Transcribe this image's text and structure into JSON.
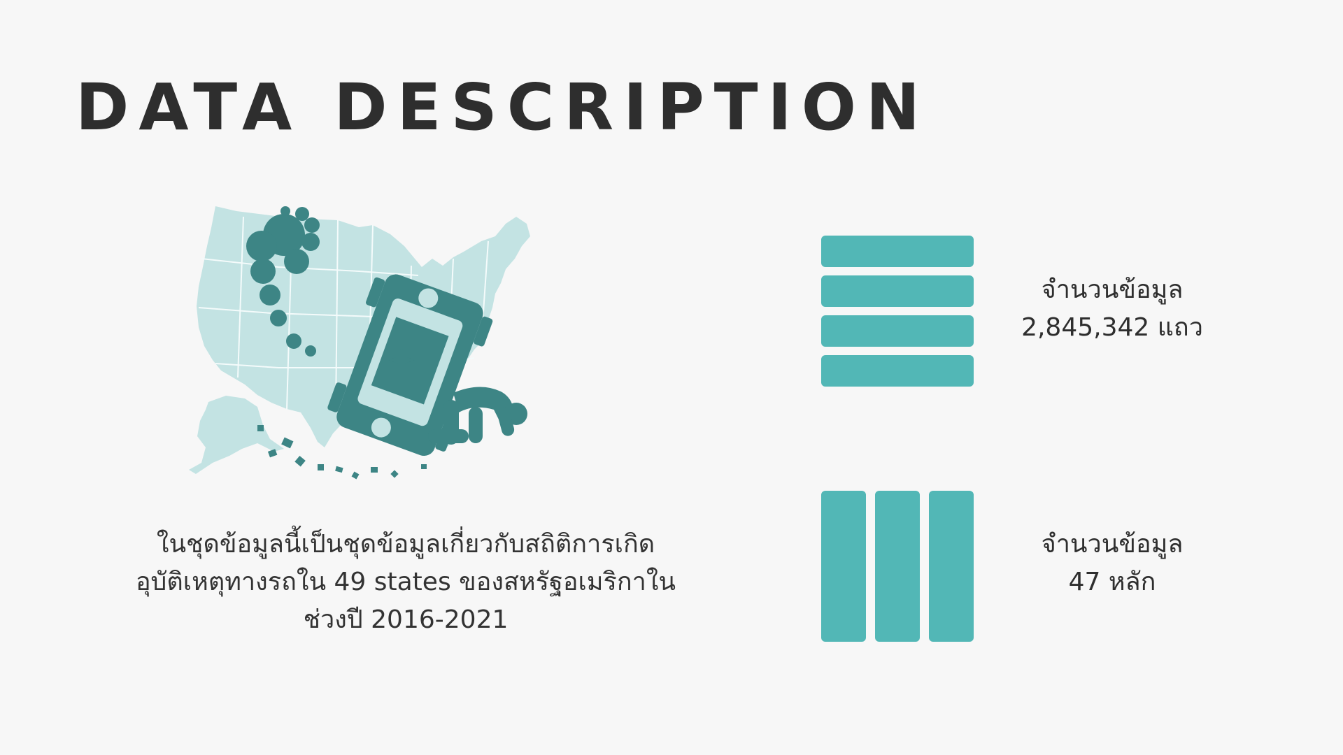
{
  "slide": {
    "title": "DATA DESCRIPTION",
    "description_lines": [
      "ในชุดข้อมูลนี้เป็นชุดข้อมูลเกี่ยวกับสถิติการเกิด",
      "อุบัติเหตุทางรถใน 49 states ของสหรัฐอเมริกาใน",
      "ช่วงปี 2016-2021"
    ],
    "stats": {
      "rows": {
        "label": "จำนวนข้อมูล",
        "value": "2,845,342 แถว",
        "icon": "table-rows-icon"
      },
      "columns": {
        "label": "จำนวนข้อมูล",
        "value": "47 หลัก",
        "icon": "table-columns-icon"
      }
    },
    "illustration": "us-map-car-accident-illustration",
    "colors": {
      "accent": "#52b7b6",
      "map_fill": "#c3e3e3",
      "illustration_dark": "#3d8585",
      "text": "#2e2e2e",
      "background": "#f7f7f7"
    }
  }
}
